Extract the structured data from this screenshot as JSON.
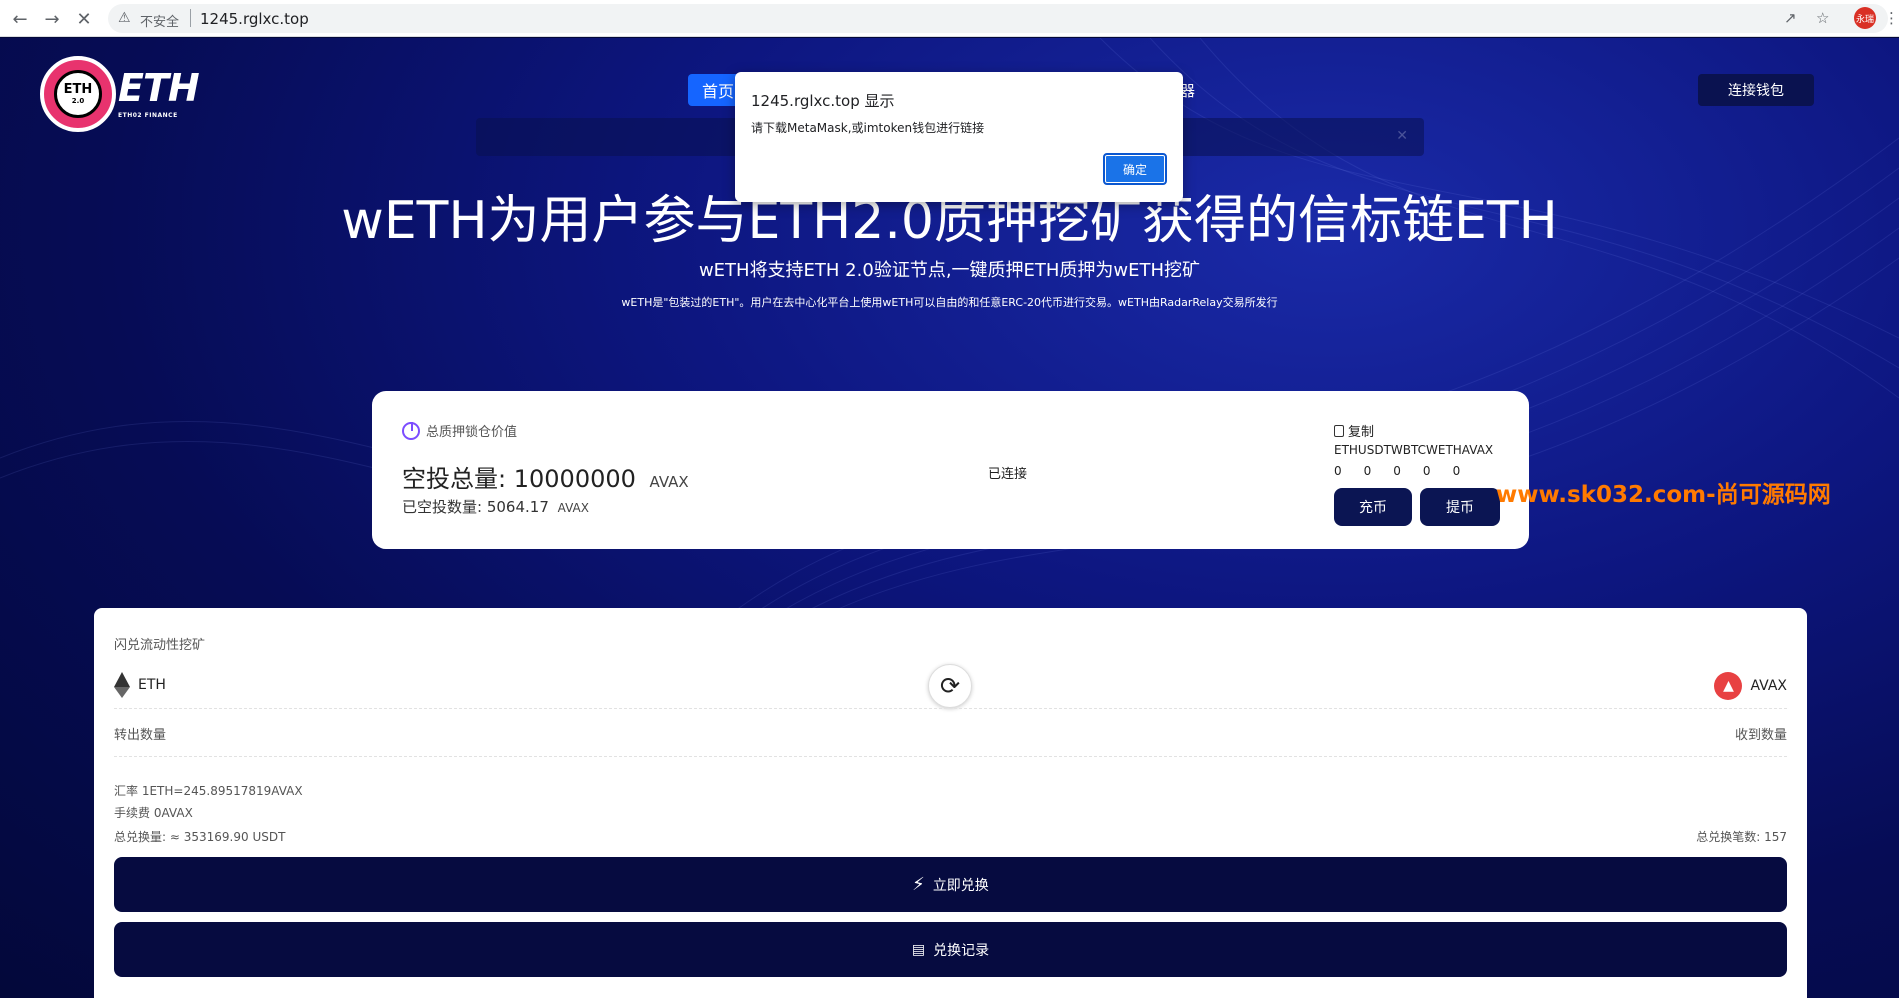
{
  "browser": {
    "insecure_label": "不安全",
    "url": "1245.rglxc.top",
    "profile_label": "永瑞"
  },
  "header": {
    "logo_badge": "ETH",
    "logo_badge_sub": "2.0",
    "logo_word": "ETH",
    "logo_sub": "ETH02 FINANCE",
    "nav_home": "首页",
    "nav_partial": "器",
    "connect_wallet": "连接钱包"
  },
  "hero": {
    "title": "wETH为用户参与ETH2.0质押挖矿获得的信标链ETH",
    "subtitle": "wETH将支持ETH 2.0验证节点,一键质押ETH质押为wETH挖矿",
    "description": "wETH是\"包装过的ETH\"。用户在去中心化平台上使用wETH可以自由的和任意ERC-20代币进行交易。wETH由RadarRelay交易所发行"
  },
  "stats": {
    "tvl_label": "总质押锁仓价值",
    "airdrop_total_label": "空投总量:",
    "airdrop_total_value": "10000000",
    "airdrop_total_unit": "AVAX",
    "airdropped_label": "已空投数量:",
    "airdropped_value": "5064.17",
    "airdropped_unit": "AVAX",
    "connected": "已连接",
    "copy_label": "复制",
    "tokens": "ETHUSDTWBTCWETHAVAX",
    "balances": [
      "0",
      "0",
      "0",
      "0",
      "0"
    ],
    "deposit_button": "充币",
    "withdraw_button": "提币"
  },
  "watermark": "www.sk032.com-尚可源码网",
  "swap": {
    "title": "闪兑流动性挖矿",
    "from_coin": "ETH",
    "to_coin": "AVAX",
    "out_amount_label": "转出数量",
    "in_amount_label": "收到数量",
    "rate_label": "汇率",
    "rate_value": "1ETH=245.89517819AVAX",
    "fee_label": "手续费",
    "fee_value": "0AVAX",
    "total_swap_label": "总兑换量:",
    "total_swap_value": "≈ 353169.90 USDT",
    "total_count_label": "总兑换笔数:",
    "total_count_value": "157",
    "swap_button": "立即兑换",
    "records_button": "兑换记录"
  },
  "dialog": {
    "title": "1245.rglxc.top 显示",
    "message": "请下载MetaMask,或imtoken钱包进行链接",
    "ok_button": "确定"
  }
}
